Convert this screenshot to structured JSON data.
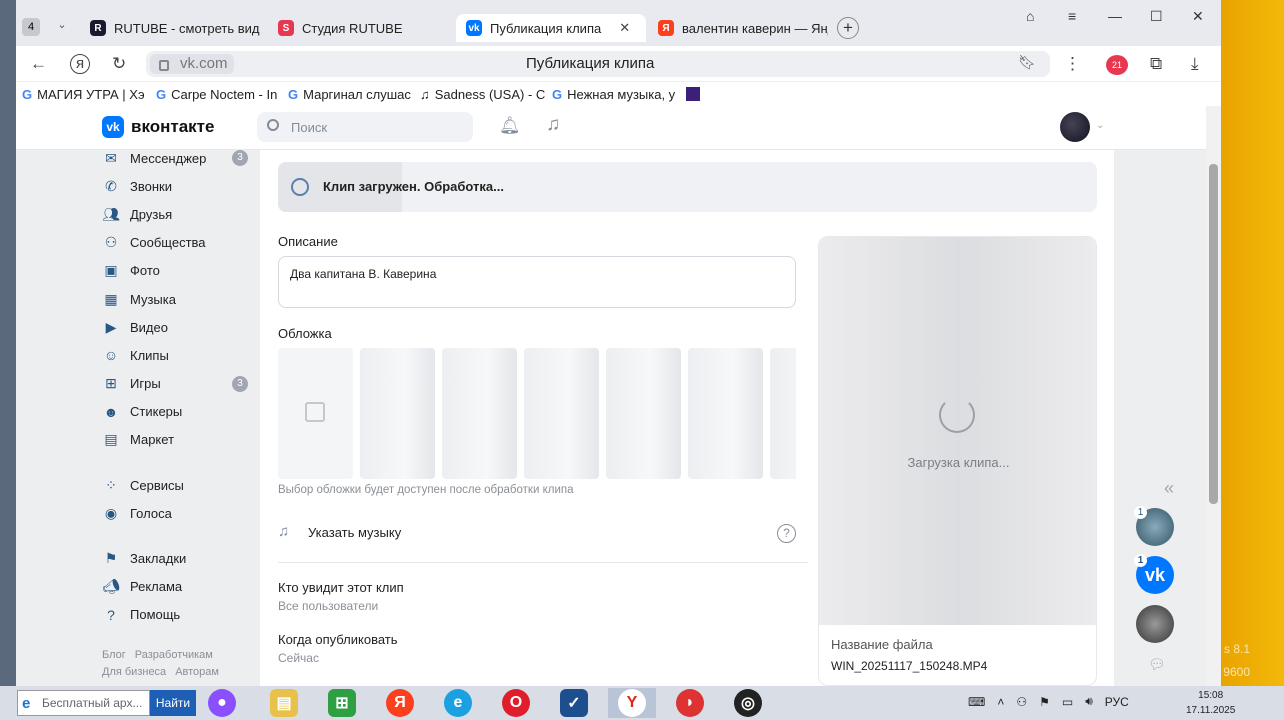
{
  "browser": {
    "tab_count": "4",
    "tabs": [
      {
        "label": "RUTUBE - смотреть видео"
      },
      {
        "label": "Студия RUTUBE"
      },
      {
        "label": "Публикация клипа"
      },
      {
        "label": "валентин каверин — Яндекс"
      }
    ],
    "url": "vk.com",
    "page_title": "Публикация клипа",
    "extension_badge": "21",
    "bookmarks": [
      {
        "label": "МАГИЯ УТРА | Хэ"
      },
      {
        "label": "Carpe Noctem - In"
      },
      {
        "label": "Маргинал слушас"
      },
      {
        "label": "Sadness (USA) - C"
      },
      {
        "label": "Нежная музыка, у"
      }
    ]
  },
  "vk": {
    "logo_text": "вконтакте",
    "search_placeholder": "Поиск",
    "sidebar": [
      {
        "label": "Мессенджер",
        "icon": "message-icon",
        "badge": "3"
      },
      {
        "label": "Звонки",
        "icon": "phone-icon"
      },
      {
        "label": "Друзья",
        "icon": "friends-icon"
      },
      {
        "label": "Сообщества",
        "icon": "communities-icon"
      },
      {
        "label": "Фото",
        "icon": "photo-icon"
      },
      {
        "label": "Музыка",
        "icon": "music-icon"
      },
      {
        "label": "Видео",
        "icon": "video-icon"
      },
      {
        "label": "Клипы",
        "icon": "clips-icon"
      },
      {
        "label": "Игры",
        "icon": "games-icon",
        "badge": "3"
      },
      {
        "label": "Стикеры",
        "icon": "stickers-icon"
      },
      {
        "label": "Маркет",
        "icon": "market-icon"
      },
      {
        "label": "Сервисы",
        "icon": "services-icon"
      },
      {
        "label": "Голоса",
        "icon": "votes-icon"
      },
      {
        "label": "Закладки",
        "icon": "bookmarks-icon"
      },
      {
        "label": "Реклама",
        "icon": "ads-icon"
      },
      {
        "label": "Помощь",
        "icon": "help-icon"
      }
    ],
    "footer_links": [
      "Блог",
      "Разработчикам",
      "Для бизнеса",
      "Авторам"
    ],
    "status_text": "Клип загружен. Обработка...",
    "description_label": "Описание",
    "description_value": "Два капитана В. Каверина",
    "cover_label": "Обложка",
    "cover_hint": "Выбор обложки будет доступен после обработки клипа",
    "music_label": "Указать музыку",
    "help_mark": "?",
    "who_label": "Кто увидит этот клип",
    "who_value": "Все пользователи",
    "when_label": "Когда опубликовать",
    "when_value": "Сейчас",
    "preview_loading": "Загрузка клипа...",
    "filename_label": "Название файла",
    "filename_value": "WIN_20251117_150248.MP4",
    "rail_badges": [
      "1",
      "1"
    ]
  },
  "desktop": {
    "watermark_lines": [
      "s 8.1",
      "9600"
    ]
  },
  "taskbar": {
    "search_text": "Бесплатный арх...",
    "search_button": "Найти",
    "language": "РУС",
    "time": "15:08",
    "date": "17.11.2025"
  },
  "colors": {
    "vk_blue": "#0077ff",
    "desktop_yellow": "#f0b000"
  }
}
